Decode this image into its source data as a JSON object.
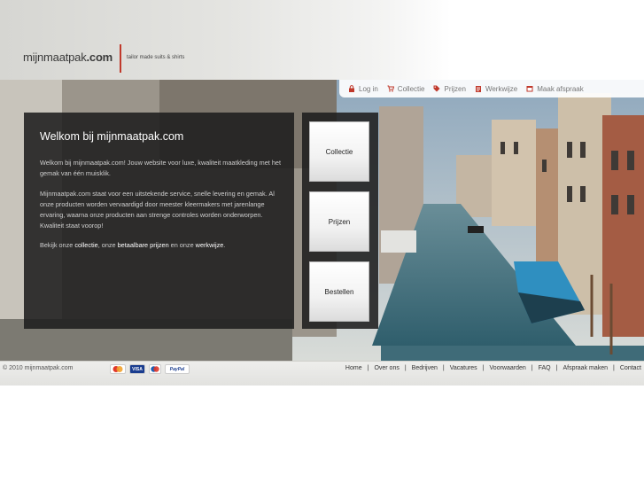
{
  "header": {
    "logo_main": "mijnmaatpak",
    "logo_tld": ".com",
    "tagline": "tailor made suits & shirts"
  },
  "topnav": [
    {
      "label": "Log in",
      "icon": "lock-icon"
    },
    {
      "label": "Collectie",
      "icon": "cart-icon"
    },
    {
      "label": "Prijzen",
      "icon": "tag-icon"
    },
    {
      "label": "Werkwijze",
      "icon": "clipboard-icon"
    },
    {
      "label": "Maak afspraak",
      "icon": "calendar-icon"
    }
  ],
  "welcome": {
    "title": "Welkom bij mijnmaatpak.com",
    "p1": "Welkom bij mijnmaatpak.com! Jouw website voor luxe, kwaliteit maatkleding met het gemak van één muisklik.",
    "p2": "Mijnmaatpak.com staat voor een uitstekende service, snelle levering en gemak. Al onze producten worden vervaardigd door meester kleermakers met jarenlange ervaring, waarna onze producten aan strenge controles worden onderworpen. Kwaliteit staat voorop!",
    "p3_a": "Bekijk onze ",
    "p3_link1": "collectie",
    "p3_b": ", onze ",
    "p3_link2": "betaalbare prijzen",
    "p3_c": " en onze ",
    "p3_link3": "werkwijze",
    "p3_d": "."
  },
  "side_buttons": [
    "Collectie",
    "Prijzen",
    "Bestellen"
  ],
  "footer": {
    "copyright": "© 2010 mijnmaatpak.com",
    "payments": [
      "mastercard-icon",
      "VISA",
      "maestro-icon",
      "PayPal"
    ],
    "links": [
      "Home",
      "Over ons",
      "Bedrijven",
      "Vacatures",
      "Voorwaarden",
      "FAQ",
      "Afspraak maken",
      "Contact"
    ]
  },
  "colors": {
    "accent_red": "#c0392b",
    "panel_bg": "#1e1e1e",
    "nav_text": "#777777"
  }
}
